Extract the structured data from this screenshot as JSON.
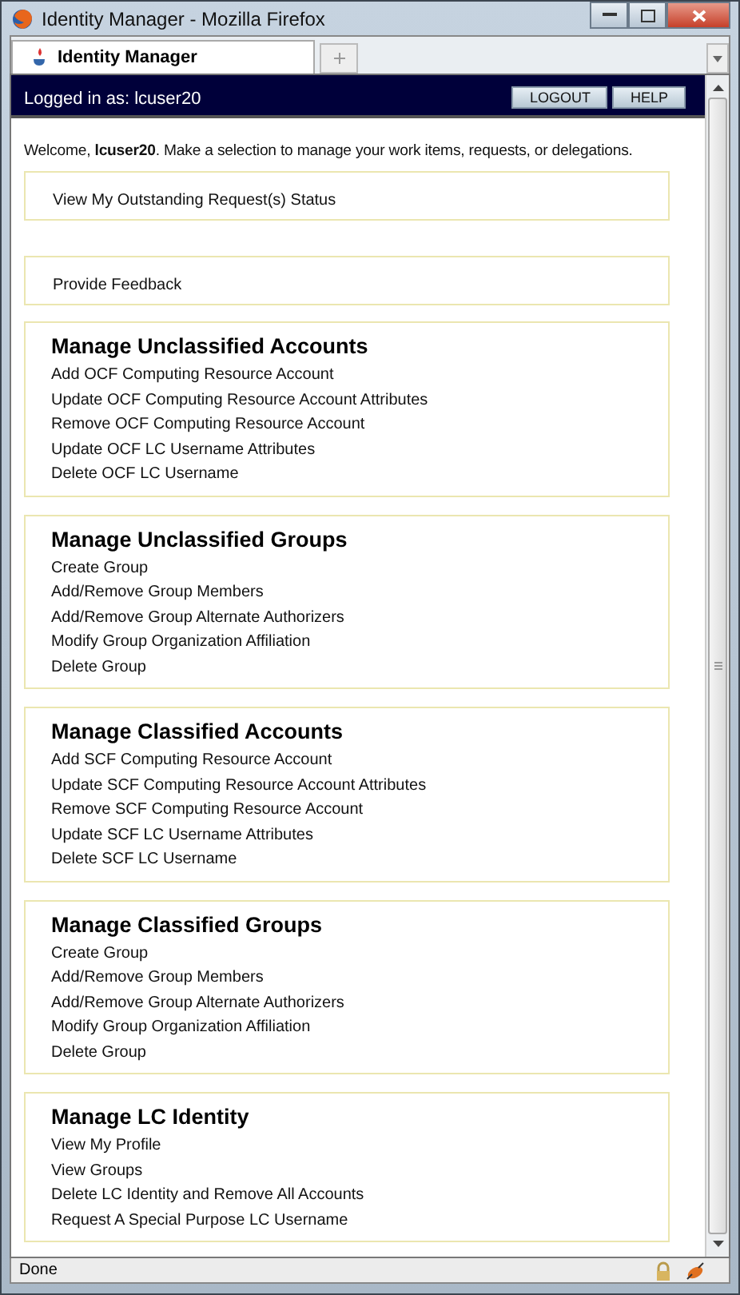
{
  "window": {
    "title": "Identity Manager - Mozilla Firefox"
  },
  "tabs": [
    {
      "label": "Identity Manager",
      "selected": true
    }
  ],
  "header": {
    "logged_in": "Logged in as: lcuser20",
    "buttons": [
      "LOGOUT",
      "HELP"
    ]
  },
  "welcome": "Welcome, **lcuser20**. Make a selection to manage your work items, requests, or delegations.",
  "link_boxes": [
    "View My Outstanding Request(s) Status",
    "Provide Feedback"
  ],
  "sections": [
    {
      "title": "Manage Unclassified Accounts",
      "items": [
        "Add OCF Computing Resource Account",
        "Update OCF Computing Resource Account Attributes",
        "Remove OCF Computing Resource Account",
        "Update OCF LC Username Attributes",
        "Delete OCF LC Username"
      ]
    },
    {
      "title": "Manage Unclassified Groups",
      "items": [
        "Create Group",
        "Add/Remove Group Members",
        "Add/Remove Group Alternate Authorizers",
        "Modify Group Organization Affiliation",
        "Delete Group"
      ]
    },
    {
      "title": "Manage Classified Accounts",
      "items": [
        "Add SCF Computing Resource Account",
        "Update SCF Computing Resource Account Attributes",
        "Remove SCF Computing Resource Account",
        "Update SCF LC Username Attributes",
        "Delete SCF LC Username"
      ]
    },
    {
      "title": "Manage Classified Groups",
      "items": [
        "Create Group",
        "Add/Remove Group Members",
        "Add/Remove Group Alternate Authorizers",
        "Modify Group Organization Affiliation",
        "Delete Group"
      ]
    },
    {
      "title": "Manage LC Identity",
      "items": [
        "View My Profile",
        "View Groups",
        "Delete LC Identity and Remove All Accounts",
        "Request A Special Purpose LC Username"
      ]
    }
  ],
  "status_bar": "Done"
}
